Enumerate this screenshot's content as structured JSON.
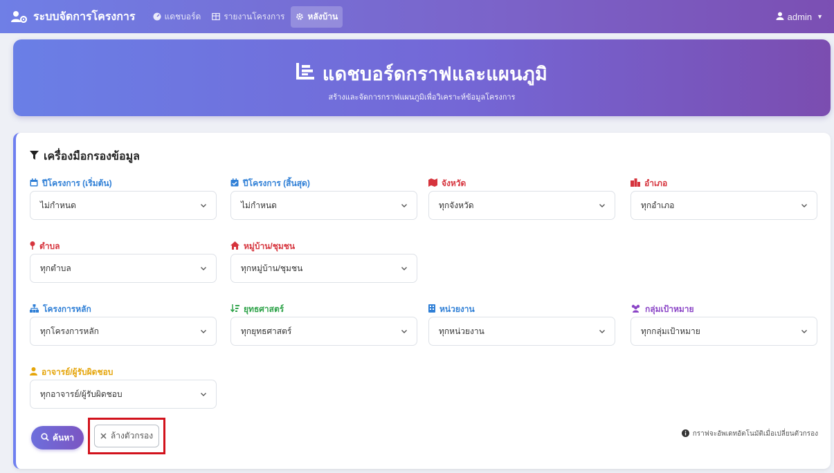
{
  "navbar": {
    "brand": "ระบบจัดการโครงการ",
    "links": [
      {
        "label": "แดชบอร์ด",
        "icon": "dashboard-icon"
      },
      {
        "label": "รายงานโครงการ",
        "icon": "table-icon"
      },
      {
        "label": "หลังบ้าน",
        "icon": "gear-icon"
      }
    ],
    "user": "admin"
  },
  "hero": {
    "title": "แดชบอร์ดกราฟและแผนภูมิ",
    "subtitle": "สร้างและจัดการกราฟแผนภูมิเพื่อวิเคราะห์ข้อมูลโครงการ"
  },
  "filter_panel": {
    "title": "เครื่องมือกรองข้อมูล",
    "fields": {
      "year_start": {
        "label": "ปีโครงการ (เริ่มต้น)",
        "value": "ไม่กำหนด",
        "color": "#2f7fd6",
        "icon": "calendar-icon"
      },
      "year_end": {
        "label": "ปีโครงการ (สิ้นสุด)",
        "value": "ไม่กำหนด",
        "color": "#2f7fd6",
        "icon": "calendar-check-icon"
      },
      "province": {
        "label": "จังหวัด",
        "value": "ทุกจังหวัด",
        "color": "#d6343d",
        "icon": "map-icon"
      },
      "district": {
        "label": "อำเภอ",
        "value": "ทุกอำเภอ",
        "color": "#d6343d",
        "icon": "city-icon"
      },
      "subdistrict": {
        "label": "ตำบล",
        "value": "ทุกตำบล",
        "color": "#d6343d",
        "icon": "pin-icon"
      },
      "village": {
        "label": "หมู่บ้าน/ชุมชน",
        "value": "ทุกหมู่บ้าน/ชุมชน",
        "color": "#d6343d",
        "icon": "home-icon"
      },
      "main_project": {
        "label": "โครงการหลัก",
        "value": "ทุกโครงการหลัก",
        "color": "#2f7fd6",
        "icon": "sitemap-icon"
      },
      "strategy": {
        "label": "ยุทธศาสตร์",
        "value": "ทุกยุทธศาสตร์",
        "color": "#2fa34a",
        "icon": "sort-icon"
      },
      "agency": {
        "label": "หน่วยงาน",
        "value": "ทุกหน่วยงาน",
        "color": "#2f7fd6",
        "icon": "building-icon"
      },
      "target_group": {
        "label": "กลุ่มเป้าหมาย",
        "value": "ทุกกลุ่มเป้าหมาย",
        "color": "#8a44c6",
        "icon": "users-icon"
      },
      "lecturer": {
        "label": "อาจารย์/ผู้รับผิดชอบ",
        "value": "ทุกอาจารย์/ผู้รับผิดชอบ",
        "color": "#e5a50a",
        "icon": "user-icon"
      }
    },
    "search_label": "ค้นหา",
    "clear_label": "ล้างตัวกรอง",
    "note": "กราฟจะอัพเดทอัตโนมัติเมื่อเปลี่ยนตัวกรอง"
  }
}
